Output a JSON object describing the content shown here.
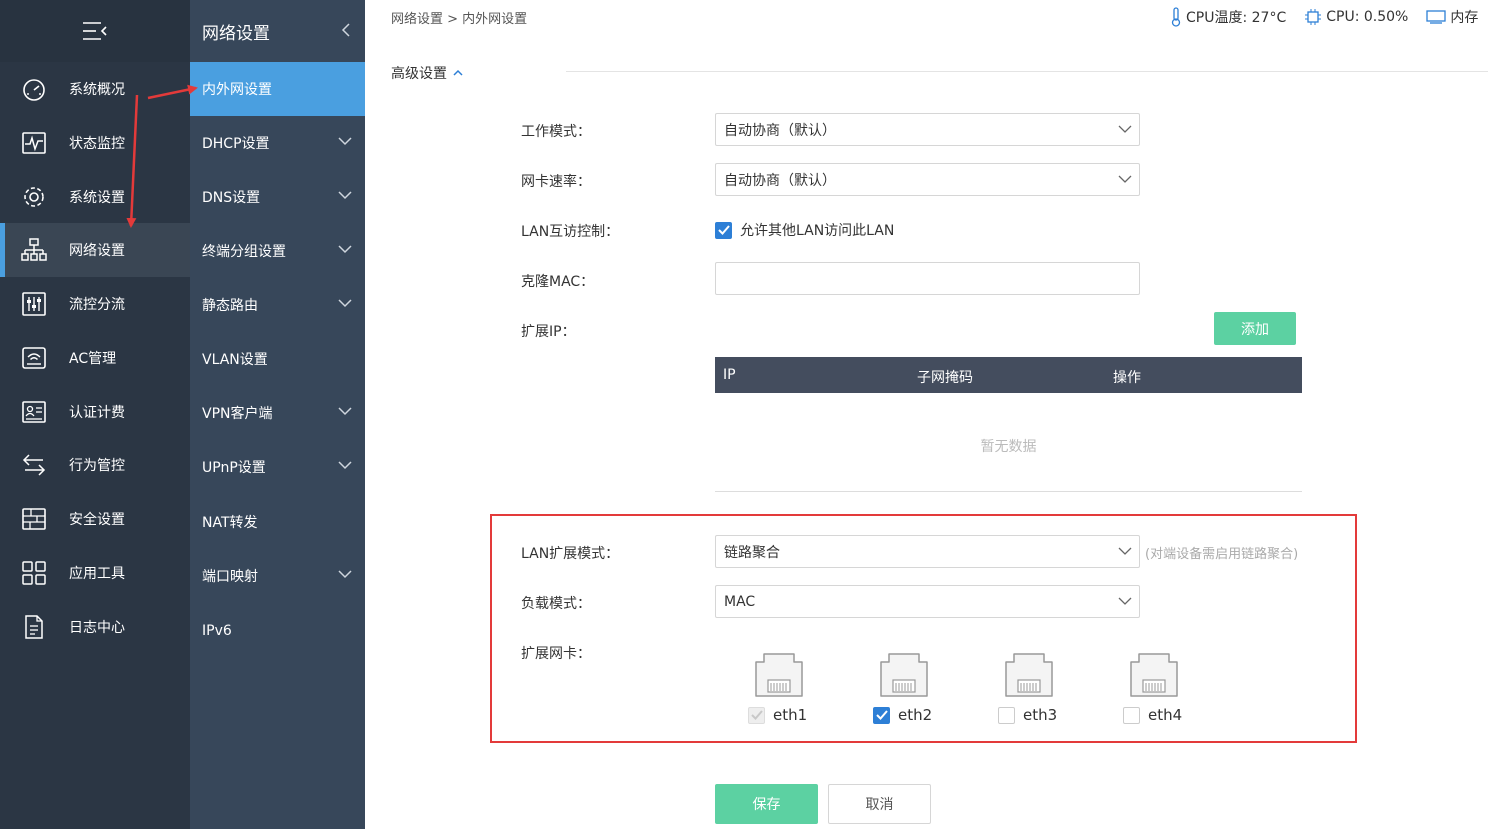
{
  "sidebar": {
    "items": [
      {
        "label": "系统概况",
        "icon": "dashboard-icon"
      },
      {
        "label": "状态监控",
        "icon": "monitor-pulse-icon"
      },
      {
        "label": "系统设置",
        "icon": "gear-icon"
      },
      {
        "label": "网络设置",
        "icon": "network-tree-icon"
      },
      {
        "label": "流控分流",
        "icon": "sliders-icon"
      },
      {
        "label": "AC管理",
        "icon": "wifi-router-icon"
      },
      {
        "label": "认证计费",
        "icon": "id-card-icon"
      },
      {
        "label": "行为管控",
        "icon": "swap-arrows-icon"
      },
      {
        "label": "安全设置",
        "icon": "firewall-icon"
      },
      {
        "label": "应用工具",
        "icon": "apps-grid-icon"
      },
      {
        "label": "日志中心",
        "icon": "document-icon"
      }
    ]
  },
  "submenu": {
    "title": "网络设置",
    "items": [
      {
        "label": "内外网设置"
      },
      {
        "label": "DHCP设置"
      },
      {
        "label": "DNS设置"
      },
      {
        "label": "终端分组设置"
      },
      {
        "label": "静态路由"
      },
      {
        "label": "VLAN设置"
      },
      {
        "label": "VPN客户端"
      },
      {
        "label": "UPnP设置"
      },
      {
        "label": "NAT转发"
      },
      {
        "label": "端口映射"
      },
      {
        "label": "IPv6"
      }
    ]
  },
  "header": {
    "breadcrumb": "网络设置 > 内外网设置",
    "cpu_temp": "CPU温度: 27°C",
    "cpu_usage": "CPU: 0.50%",
    "memory": "内存"
  },
  "advanced": {
    "title": "高级设置",
    "work_mode_label": "工作模式：",
    "work_mode_value": "自动协商（默认）",
    "nic_speed_label": "网卡速率：",
    "nic_speed_value": "自动协商（默认）",
    "lan_ctrl_label": "LAN互访控制：",
    "lan_ctrl_option": "允许其他LAN访问此LAN",
    "clone_mac_label": "克隆MAC：",
    "clone_mac_value": "",
    "ext_ip_label": "扩展IP：",
    "add_button": "添加",
    "table_headers": [
      "IP",
      "子网掩码",
      "操作"
    ],
    "no_data": "暂无数据",
    "lan_ext_mode_label": "LAN扩展模式：",
    "lan_ext_mode_value": "链路聚合",
    "lan_ext_hint": "(对端设备需启用链路聚合)",
    "load_mode_label": "负载模式：",
    "load_mode_value": "MAC",
    "ext_nic_label": "扩展网卡：",
    "ports": [
      {
        "name": "eth1",
        "checked": true,
        "disabled": true
      },
      {
        "name": "eth2",
        "checked": true,
        "disabled": false
      },
      {
        "name": "eth3",
        "checked": false,
        "disabled": false
      },
      {
        "name": "eth4",
        "checked": false,
        "disabled": false
      }
    ]
  },
  "actions": {
    "save": "保存",
    "cancel": "取消"
  },
  "colors": {
    "sidebar_bg": "#2b3644",
    "submenu_bg": "#37475a",
    "active_blue": "#4a9fe0",
    "green_button": "#5cd1a2",
    "table_header": "#444d5e",
    "annotation_red": "#e33a3a"
  }
}
